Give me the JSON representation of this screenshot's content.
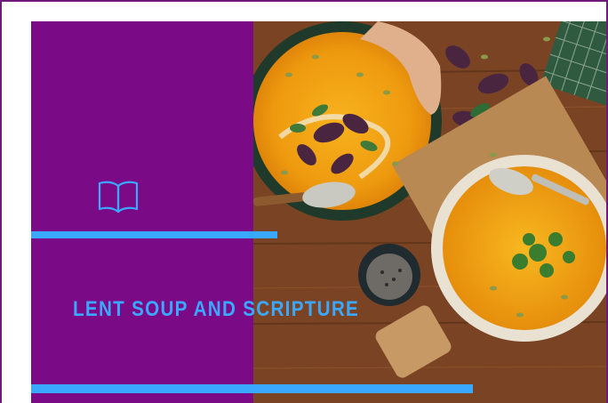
{
  "slide": {
    "title": "LENT SOUP AND SCRIPTURE",
    "icon": "open-book-icon",
    "image": "pumpkin-soup-bowls-photo"
  },
  "colors": {
    "panel": "#7b0a86",
    "accent": "#3aa8ff",
    "border": "#6e1a78",
    "background": "#ffffff"
  }
}
